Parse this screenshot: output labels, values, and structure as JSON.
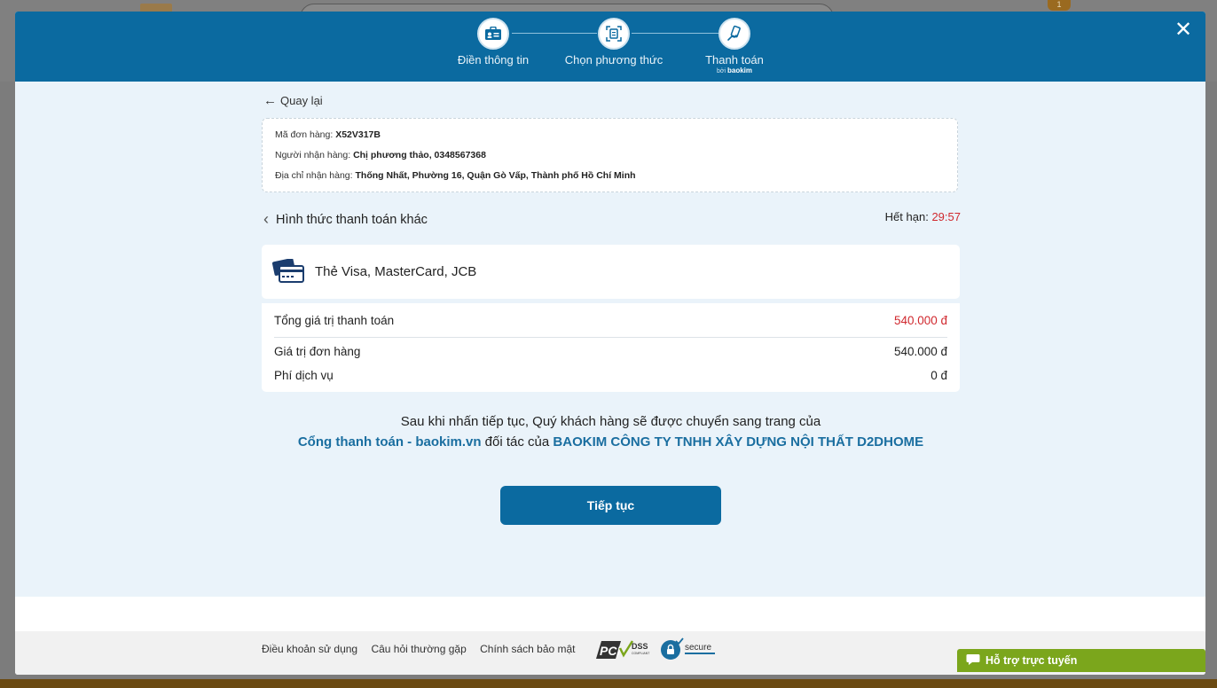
{
  "backdrop": {
    "cart_badge": "1"
  },
  "steps": [
    {
      "label": "Điền thông tin",
      "icon": "id-card-icon"
    },
    {
      "label": "Chọn phương thức",
      "icon": "document-scan-icon"
    },
    {
      "label": "Thanh toán",
      "icon": "payment-hand-icon",
      "sub_prefix": "bởi",
      "sub_brand": "baokim"
    }
  ],
  "nav": {
    "back_label": "Quay lại"
  },
  "order": {
    "code_label": "Mã đơn hàng:",
    "code_value": "X52V317B",
    "receiver_label": "Người nhận hàng:",
    "receiver_value": "Chị phương thảo, 0348567368",
    "address_label": "Địa chỉ nhận hàng:",
    "address_value": "Thống Nhất, Phường 16, Quận Gò Vấp, Thành phố Hồ Chí Minh"
  },
  "payment": {
    "section_title": "Hình thức thanh toán khác",
    "expire_label": "Hết hạn:",
    "expire_time": "29:57",
    "method_label": "Thẻ Visa, MasterCard, JCB"
  },
  "summary": {
    "total_label": "Tổng giá trị thanh toán",
    "total_value": "540.000 đ",
    "order_label": "Giá trị đơn hàng",
    "order_value": "540.000 đ",
    "fee_label": "Phí dịch vụ",
    "fee_value": "0 đ"
  },
  "notice": {
    "line1": "Sau khi nhấn tiếp tục, Quý khách hàng sẽ được chuyển sang trang của",
    "gateway": "Cổng thanh toán - baokim.vn",
    "middle": " đối tác của ",
    "merchant": "BAOKIM CÔNG TY TNHH XÂY DỰNG NỘI THẤT D2DHOME"
  },
  "actions": {
    "continue_label": "Tiếp tục"
  },
  "footer": {
    "terms": "Điều khoản sử dụng",
    "faq": "Câu hỏi thường gặp",
    "privacy": "Chính sách bảo mật",
    "pci_text": "PCI",
    "dss_text": "DSS",
    "pci_sub": "COMPLIANT",
    "secure_text": "secure"
  },
  "support": {
    "label": "Hỗ trợ trực tuyến"
  },
  "colors": {
    "primary": "#0b6aa0",
    "accent_red": "#d0282e",
    "support_green": "#7ba61c"
  }
}
